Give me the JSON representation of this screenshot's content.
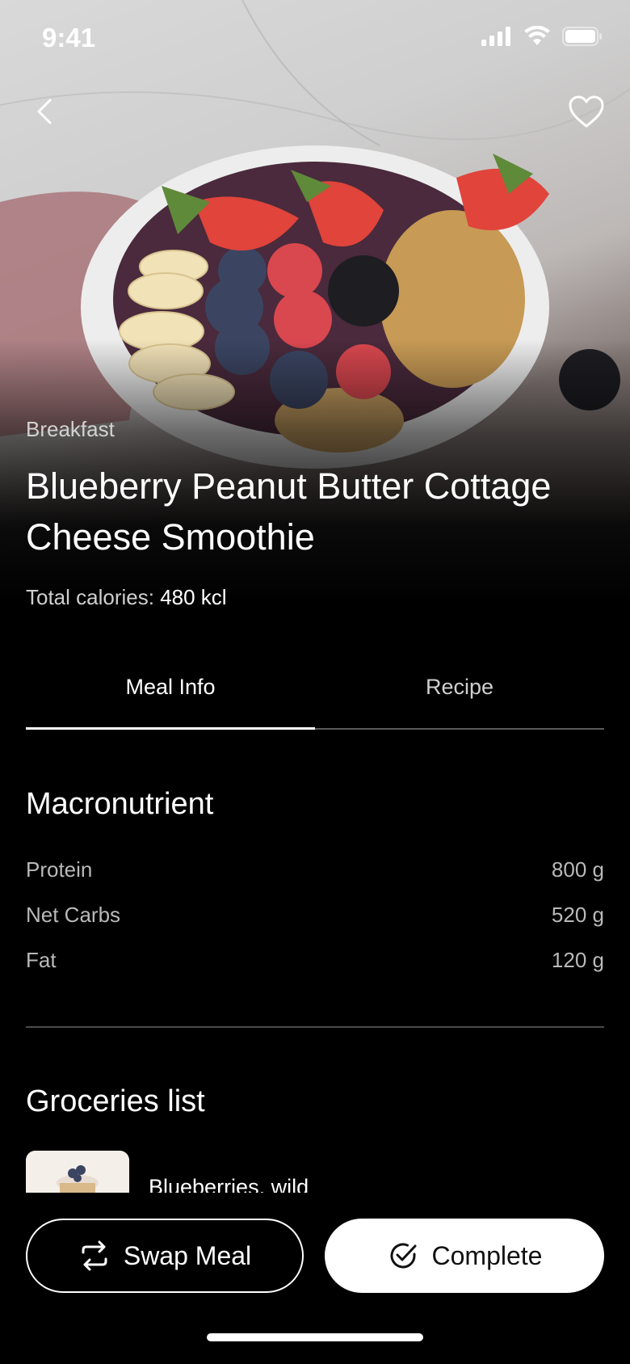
{
  "status_bar": {
    "time": "9:41",
    "icons": [
      "signal-icon",
      "wifi-icon",
      "battery-icon"
    ]
  },
  "nav": {
    "back_icon": "chevron-left-icon",
    "favorite_icon": "heart-icon"
  },
  "meal": {
    "category": "Breakfast",
    "title": "Blueberry Peanut Butter Cottage Cheese Smoothie",
    "calories_label": "Total calories:",
    "calories_value": "480 kcl"
  },
  "tabs": [
    {
      "label": "Meal Info",
      "active": true
    },
    {
      "label": "Recipe",
      "active": false
    }
  ],
  "macronutrient": {
    "heading": "Macronutrient",
    "rows": [
      {
        "label": "Protein",
        "value": "800 g"
      },
      {
        "label": "Net Carbs",
        "value": "520 g"
      },
      {
        "label": "Fat",
        "value": "120 g"
      }
    ]
  },
  "groceries": {
    "heading": "Groceries list",
    "items": [
      {
        "name": "Blueberries, wild"
      }
    ]
  },
  "actions": {
    "swap_label": "Swap Meal",
    "complete_label": "Complete"
  },
  "colors": {
    "background": "#000000",
    "text": "#ffffff",
    "muted": "#cfcfcf",
    "button_fill": "#ffffff"
  }
}
